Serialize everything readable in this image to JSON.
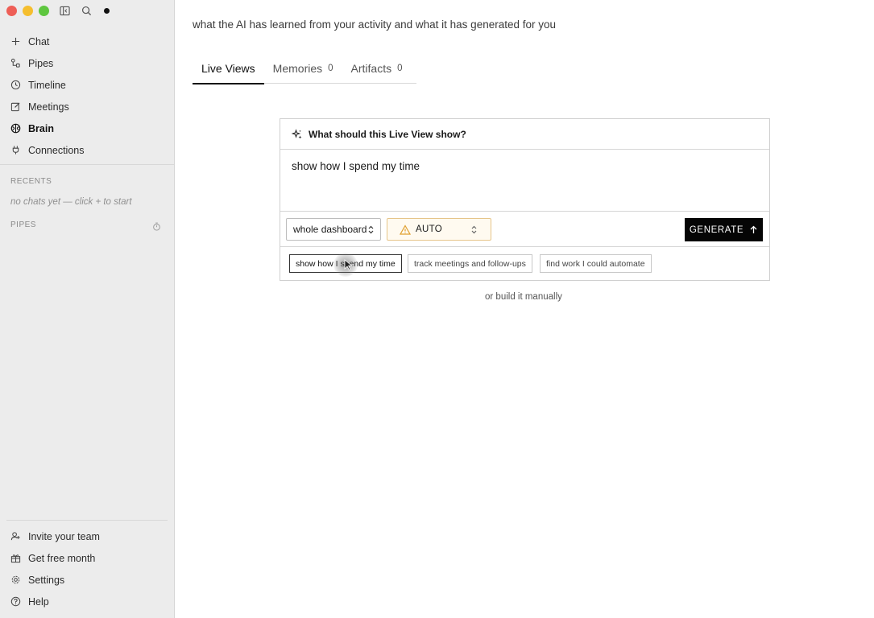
{
  "sidebar": {
    "nav": [
      {
        "label": "Chat",
        "icon": "plus-icon"
      },
      {
        "label": "Pipes",
        "icon": "pipes-icon"
      },
      {
        "label": "Timeline",
        "icon": "clock-icon"
      },
      {
        "label": "Meetings",
        "icon": "edit-note-icon"
      },
      {
        "label": "Brain",
        "icon": "brain-icon",
        "active": true
      },
      {
        "label": "Connections",
        "icon": "plug-icon"
      }
    ],
    "recents_label": "RECENTS",
    "recents_empty": "no chats yet — click + to start",
    "pipes_label": "PIPES",
    "bottom": [
      {
        "label": "Invite your team",
        "icon": "user-plus-icon"
      },
      {
        "label": "Get free month",
        "icon": "gift-icon"
      },
      {
        "label": "Settings",
        "icon": "gear-icon"
      },
      {
        "label": "Help",
        "icon": "help-icon"
      }
    ]
  },
  "main": {
    "subtitle": "what the AI has learned from your activity and what it has generated for you",
    "tabs": [
      {
        "label": "Live Views",
        "count": "",
        "active": true
      },
      {
        "label": "Memories",
        "count": "0"
      },
      {
        "label": "Artifacts",
        "count": "0"
      }
    ],
    "card": {
      "question": "What should this Live View show?",
      "prompt_value": "show how I spend my time",
      "scope_select": "whole dashboard",
      "model_select": "AUTO",
      "generate_label": "GENERATE",
      "suggestions": [
        "show how I spend my time",
        "track meetings and follow-ups",
        "find work I could automate"
      ]
    },
    "manual_link": "or build it manually"
  },
  "colors": {
    "sidebar_bg": "#ececec",
    "accent_dark": "#050505",
    "warning": "#e0a030"
  }
}
